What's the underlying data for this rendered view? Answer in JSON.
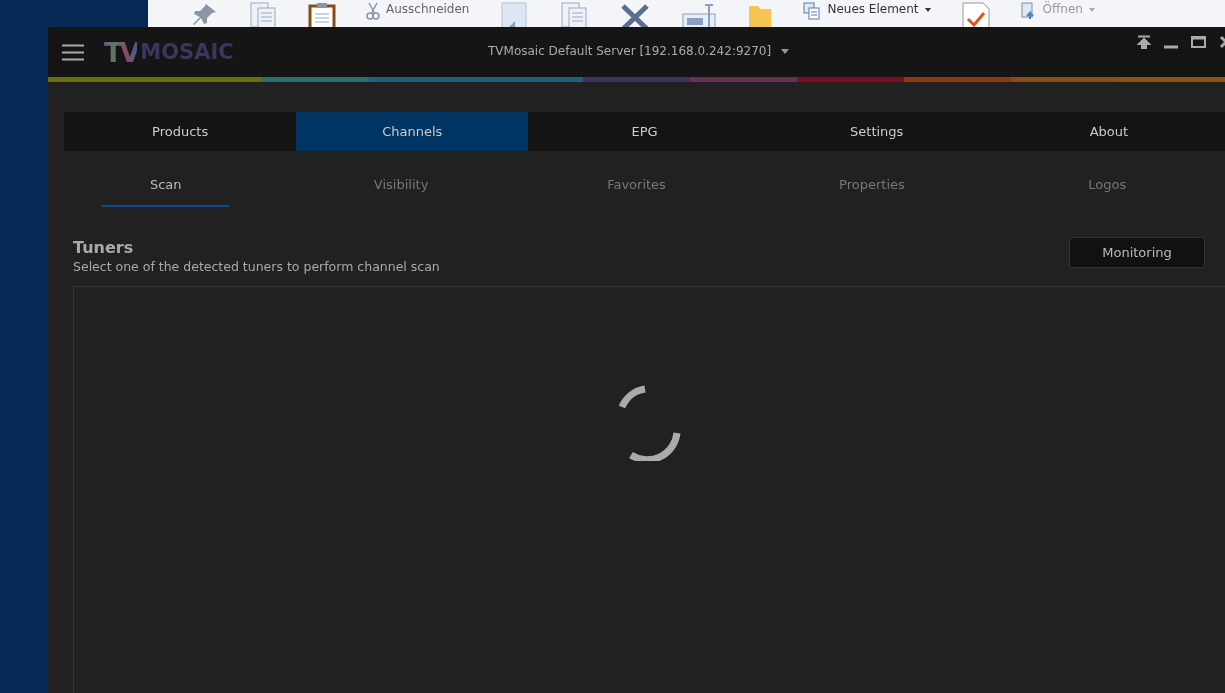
{
  "ribbon": {
    "cut": {
      "label": "Ausschneiden"
    },
    "new_item": {
      "label": "Neues Element",
      "disabled": false
    },
    "open": {
      "label": "Öffnen",
      "disabled": true
    }
  },
  "window": {
    "logo": {
      "mark": "TV",
      "name": "MOSAIC"
    },
    "server": "TVMosaic Default Server [192.168.0.242:9270]"
  },
  "tabs": [
    {
      "label": "Products",
      "selected": false
    },
    {
      "label": "Channels",
      "selected": true
    },
    {
      "label": "EPG",
      "selected": false
    },
    {
      "label": "Settings",
      "selected": false
    },
    {
      "label": "About",
      "selected": false
    }
  ],
  "subtabs": [
    {
      "label": "Scan",
      "selected": true
    },
    {
      "label": "Visibility",
      "selected": false
    },
    {
      "label": "Favorites",
      "selected": false
    },
    {
      "label": "Properties",
      "selected": false
    },
    {
      "label": "Logos",
      "selected": false
    }
  ],
  "section": {
    "title": "Tuners",
    "subtitle": "Select one of the detected tuners to perform channel scan",
    "button": "Monitoring",
    "loading": true
  }
}
